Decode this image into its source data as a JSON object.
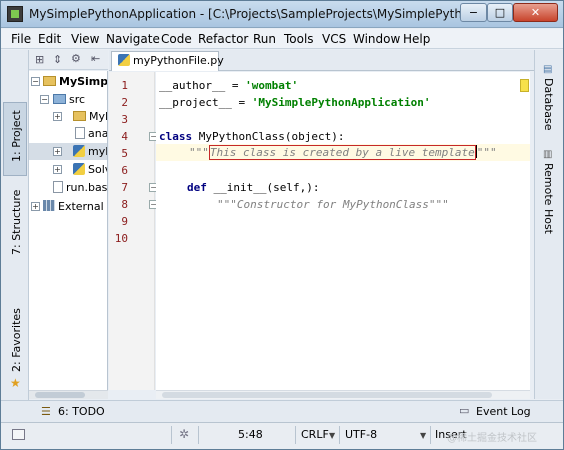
{
  "window": {
    "title": "MySimplePythonApplication - [C:\\Projects\\SampleProjects\\MySimplePythonA...",
    "minimize": "−",
    "maximize": "□",
    "close": "✕"
  },
  "menu": [
    "File",
    "Edit",
    "View",
    "Navigate",
    "Code",
    "Refactor",
    "Run",
    "Tools",
    "VCS",
    "Window",
    "Help"
  ],
  "left_tabs": {
    "project": "1: Project",
    "structure": "7: Structure",
    "favorites": "2: Favorites"
  },
  "right_tabs": {
    "database": "Database",
    "remote_host": "Remote Host"
  },
  "project_tree": [
    {
      "label": "MySimpleP",
      "bold": true
    },
    {
      "label": "src"
    },
    {
      "label": "MyP"
    },
    {
      "label": "ana"
    },
    {
      "label": "myP"
    },
    {
      "label": "Solv"
    },
    {
      "label": "run.bash"
    },
    {
      "label": "External Libr"
    }
  ],
  "editor": {
    "tab_label": "myPythonFile.py",
    "line_numbers": [
      "1",
      "2",
      "3",
      "4",
      "5",
      "6",
      "7",
      "8",
      "9",
      "10"
    ],
    "current_line": 5,
    "lines": {
      "l1_name": "__author__",
      "l1_eq": " = ",
      "l1_val": "'wombat'",
      "l2_name": "__project__",
      "l2_eq": " = ",
      "l2_val": "'MySimplePythonApplication'",
      "l4_kw": "class",
      "l4_rest": " MyPythonClass(object):",
      "l5_open": "\"\"\"",
      "l5_text": "This class is created by a live template",
      "l5_close": "\"\"\"",
      "l7_kw": "def",
      "l7_rest": " __init__(self,):",
      "l8_doc": "\"\"\"Constructor for MyPythonClass\"\"\""
    }
  },
  "toolbar": {
    "todo": "6: TODO",
    "event_log": "Event Log"
  },
  "status": {
    "position": "5:48",
    "line_sep": "CRLF",
    "encoding": "UTF-8",
    "insert_mode": "Insert",
    "watermark": "@稀土掘金技术社区"
  }
}
